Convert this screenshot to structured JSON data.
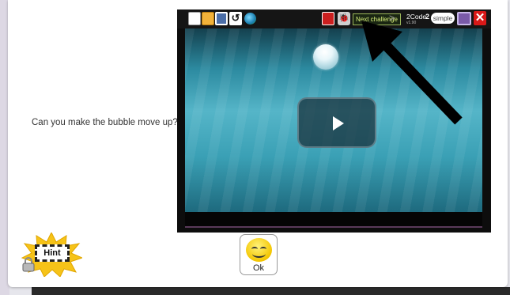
{
  "activity": {
    "question": "Can you make the bubble move up?"
  },
  "player": {
    "toolbar": {
      "reset_glyph": "↺",
      "bug_glyph": "🐞",
      "next_challenge_label": "Next challenge",
      "next_arrow": ">",
      "app_name": "2Code",
      "app_version": "v1.90",
      "level_number": "2",
      "mode_label": "simple",
      "close_glyph": "✕"
    },
    "icons": [
      "new-file-icon",
      "open-folder-icon",
      "save-icon",
      "reset-icon",
      "globe-icon",
      "stop-icon",
      "debug-bug-icon",
      "screen-icon",
      "close-icon"
    ]
  },
  "hint": {
    "label": "Hint",
    "locked": true
  },
  "ok_button": {
    "label": "Ok"
  },
  "colors": {
    "stage_top": "#14404e",
    "stage_mid": "#55b5c8",
    "close_red": "#d81818",
    "hint_star": "#f6c318",
    "next_challenge_text": "#d8f07a"
  }
}
